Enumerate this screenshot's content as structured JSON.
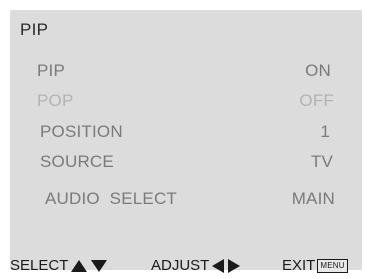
{
  "menu": {
    "title": "PIP",
    "items": [
      {
        "label": "PIP",
        "value": "ON",
        "state": "enabled"
      },
      {
        "label": "POP",
        "value": "OFF",
        "state": "disabled"
      },
      {
        "label": "POSITION",
        "value": "1",
        "state": "enabled"
      },
      {
        "label": "SOURCE",
        "value": "TV",
        "state": "enabled"
      },
      {
        "label": "AUDIO  SELECT",
        "value": "MAIN",
        "state": "enabled"
      }
    ]
  },
  "footer": {
    "select_label": "SELECT",
    "select_icons": [
      "up-arrow-icon",
      "down-arrow-icon"
    ],
    "adjust_label": "ADJUST",
    "adjust_icons": [
      "left-arrow-icon",
      "right-arrow-icon"
    ],
    "exit_label": "EXIT",
    "exit_key": "MENU"
  },
  "colors": {
    "panel_background": "#dcdcdc",
    "enabled_text": "#7a7a7a",
    "disabled_text": "#b3b3b3",
    "title_text": "#2a2a2a",
    "footer_text": "#1a1a1a"
  }
}
